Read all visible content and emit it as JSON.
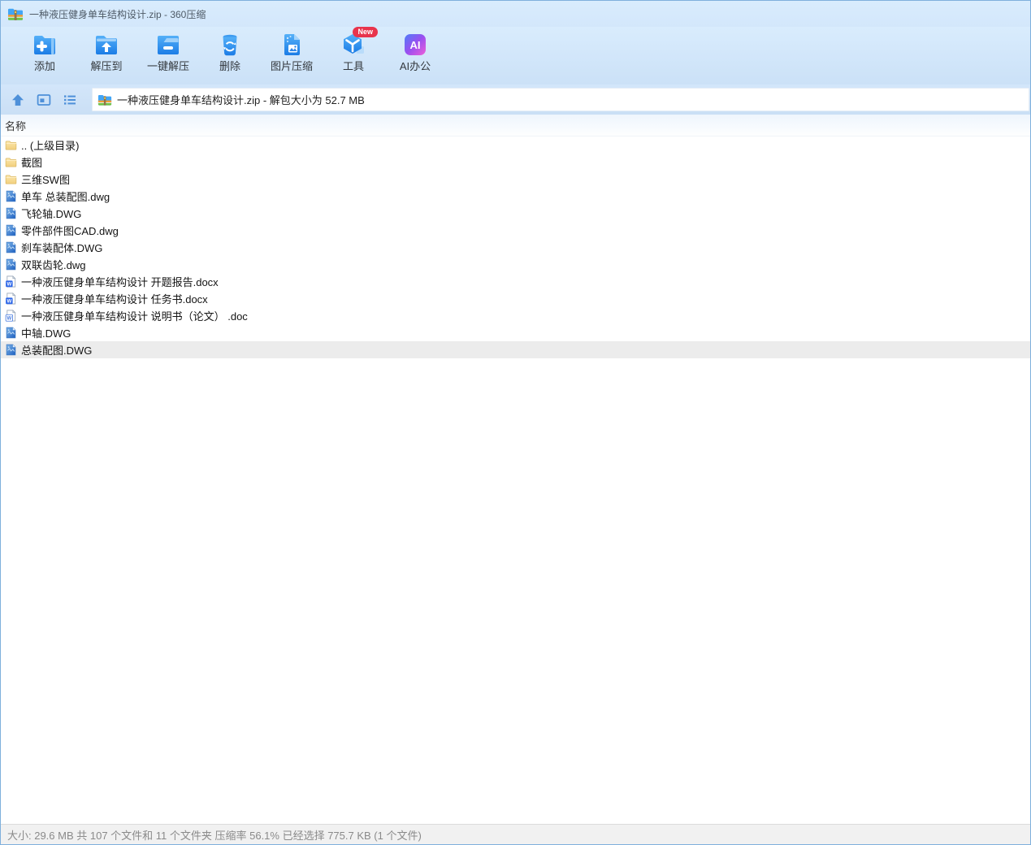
{
  "window": {
    "title": "一种液压健身单车结构设计.zip - 360压缩"
  },
  "toolbar": {
    "buttons": [
      {
        "label": "添加",
        "icon": "add-archive-icon"
      },
      {
        "label": "解压到",
        "icon": "extract-to-icon"
      },
      {
        "label": "一键解压",
        "icon": "one-click-extract-icon"
      },
      {
        "label": "删除",
        "icon": "delete-icon"
      },
      {
        "label": "图片压缩",
        "icon": "image-compress-icon"
      },
      {
        "label": "工具",
        "icon": "tools-icon",
        "badge": "New"
      },
      {
        "label": "AI办公",
        "icon": "ai-office-icon"
      }
    ]
  },
  "navbar": {
    "address": "一种液压健身单车结构设计.zip - 解包大小为 52.7 MB"
  },
  "file_list": {
    "header": "名称",
    "rows": [
      {
        "name": ".. (上级目录)",
        "icon": "folder",
        "selected": false
      },
      {
        "name": "截图",
        "icon": "folder",
        "selected": false
      },
      {
        "name": "三维SW图",
        "icon": "folder",
        "selected": false
      },
      {
        "name": "单车 总装配图.dwg",
        "icon": "dwg",
        "selected": false
      },
      {
        "name": "飞轮轴.DWG",
        "icon": "dwg",
        "selected": false
      },
      {
        "name": "零件部件图CAD.dwg",
        "icon": "dwg",
        "selected": false
      },
      {
        "name": "刹车装配体.DWG",
        "icon": "dwg",
        "selected": false
      },
      {
        "name": "双联齿轮.dwg",
        "icon": "dwg",
        "selected": false
      },
      {
        "name": "一种液压健身单车结构设计 开题报告.docx",
        "icon": "docx",
        "selected": false
      },
      {
        "name": "一种液压健身单车结构设计 任务书.docx",
        "icon": "docx",
        "selected": false
      },
      {
        "name": "一种液压健身单车结构设计 说明书（论文） .doc",
        "icon": "doc",
        "selected": false
      },
      {
        "name": "中轴.DWG",
        "icon": "dwg",
        "selected": false
      },
      {
        "name": "总装配图.DWG",
        "icon": "dwg",
        "selected": true
      }
    ]
  },
  "statusbar": {
    "text": "大小: 29.6 MB 共 107 个文件和 11 个文件夹 压缩率 56.1% 已经选择 775.7 KB (1 个文件)"
  },
  "colors": {
    "accent_blue": "#1f7fe8",
    "chrome_blue": "#d9ecfd",
    "selection_gray": "#ececec",
    "badge_red": "#e8344c",
    "folder_yellow": "#f5d789"
  }
}
